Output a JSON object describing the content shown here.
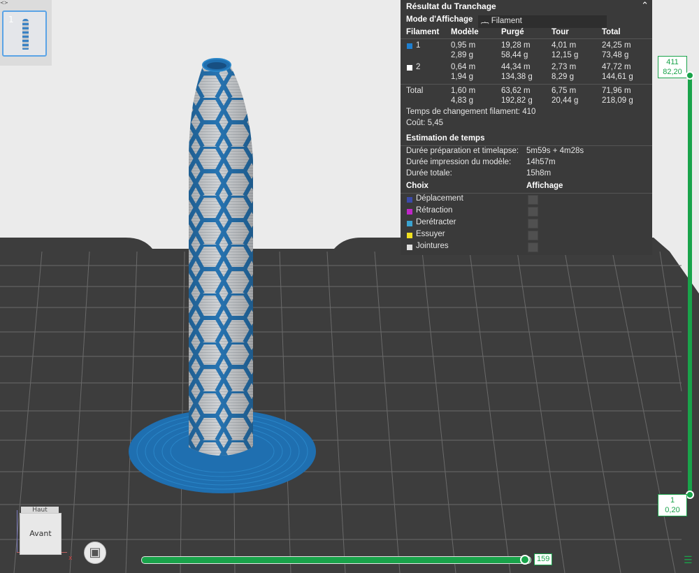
{
  "plate": {
    "number": "1"
  },
  "panel": {
    "title": "Résultat du Tranchage",
    "view_mode_label": "Mode d'Affichage",
    "view_mode_value": "Filament",
    "headers": [
      "Filament",
      "Modèle",
      "Purgé",
      "Tour",
      "Total"
    ],
    "filaments": [
      {
        "id": "1",
        "color": "#1e7fd0",
        "model": [
          "0,95 m",
          "2,89 g"
        ],
        "purged": [
          "19,28 m",
          "58,44 g"
        ],
        "tower": [
          "4,01 m",
          "12,15 g"
        ],
        "total": [
          "24,25 m",
          "73,48 g"
        ]
      },
      {
        "id": "2",
        "color": "#ffffff",
        "model": [
          "0,64 m",
          "1,94 g"
        ],
        "purged": [
          "44,34 m",
          "134,38 g"
        ],
        "tower": [
          "2,73 m",
          "8,29 g"
        ],
        "total": [
          "47,72 m",
          "144,61 g"
        ]
      }
    ],
    "totals": {
      "label": "Total",
      "model": [
        "1,60 m",
        "4,83 g"
      ],
      "purged": [
        "63,62 m",
        "192,82 g"
      ],
      "tower": [
        "6,75 m",
        "20,44 g"
      ],
      "total": [
        "71,96 m",
        "218,09 g"
      ]
    },
    "change_time": "Temps de changement filament:  410",
    "cost": "Coût:  5,45",
    "time_estimate_title": "Estimation de temps",
    "time_rows": [
      {
        "label": "Durée préparation et timelapse:",
        "value": "5m59s + 4m28s"
      },
      {
        "label": "Durée impression du modèle:",
        "value": "14h57m"
      },
      {
        "label": "Durée totale:",
        "value": "15h8m"
      }
    ],
    "options_header": "Choix",
    "display_header": "Affichage",
    "legend": [
      {
        "label": "Déplacement",
        "color": "#3b4aa8"
      },
      {
        "label": "Rétraction",
        "color": "#c026c8"
      },
      {
        "label": "Derétracter",
        "color": "#3aa3d0"
      },
      {
        "label": "Essuyer",
        "color": "#f0e020"
      },
      {
        "label": "Jointures",
        "color": "#e0e0e0"
      }
    ]
  },
  "layer_slider": {
    "top_layer": "411",
    "top_height": "82,20",
    "bottom_layer": "1",
    "bottom_height": "0,20"
  },
  "move_slider": {
    "value": "159"
  },
  "view_cube": {
    "top": "Haut",
    "front": "Avant",
    "x_axis": "x"
  },
  "colors": {
    "accent": "#19a34a",
    "bed": "#3c3c3c",
    "filament_1": "#1e7fd0",
    "filament_2": "#c8c8c8"
  }
}
